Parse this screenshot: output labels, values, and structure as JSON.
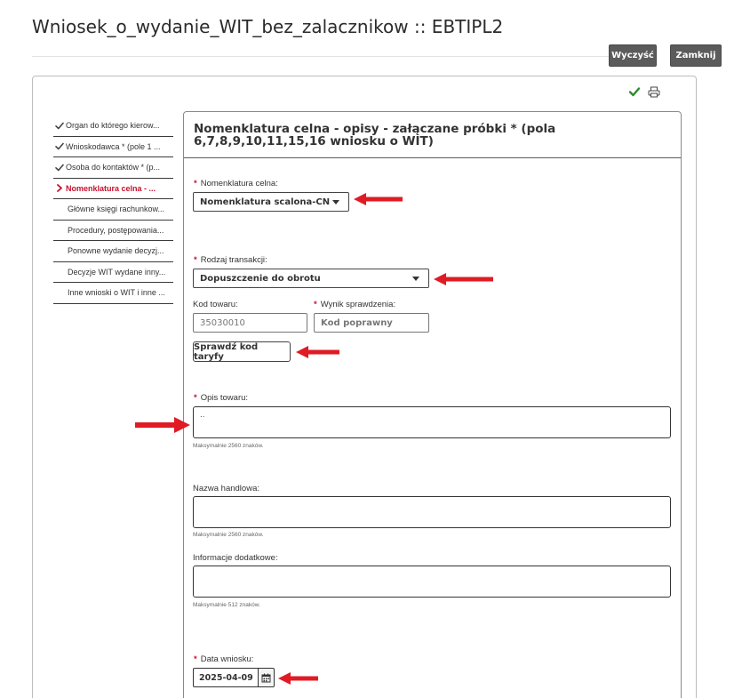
{
  "page": {
    "title": "Wniosek_o_wydanie_WIT_bez_zalacznikow :: EBTIPL2"
  },
  "toolbar": {
    "clear_label": "Wyczyść",
    "close_label": "Zamknij"
  },
  "icons": {
    "status": "check-icon",
    "print": "print-icon"
  },
  "colors": {
    "accent": "#c8102e",
    "check": "#2e8b2e",
    "button_dark": "#5b5b5b"
  },
  "sidebar": {
    "items": [
      {
        "label": "Organ do którego kierow...",
        "state": "done"
      },
      {
        "label": "Wnioskodawca * (pole 1 ...",
        "state": "done"
      },
      {
        "label": "Osoba do kontaktów * (p...",
        "state": "done"
      },
      {
        "label": "Nomenklatura celna - ...",
        "state": "active"
      },
      {
        "label": "Główne księgi rachunkow...",
        "state": "none"
      },
      {
        "label": "Procedury, postępowania...",
        "state": "none"
      },
      {
        "label": "Ponowne wydanie decyzj...",
        "state": "none"
      },
      {
        "label": "Decyzje WIT wydane inny...",
        "state": "none"
      },
      {
        "label": "Inne wnioski o WIT i inne ...",
        "state": "none"
      }
    ]
  },
  "section": {
    "title": "Nomenklatura celna - opisy - załączane próbki * (pola 6,7,8,9,10,11,15,16 wniosku o WIT)"
  },
  "form": {
    "required_mark": "*",
    "nomenclature": {
      "label": "Nomenklatura celna:",
      "value": "Nomenklatura scalona-CN"
    },
    "transaction": {
      "label": "Rodzaj transakcji:",
      "value": "Dopuszczenie do obrotu"
    },
    "goods_code": {
      "label": "Kod towaru:",
      "value": "35030010"
    },
    "check_result": {
      "label": "Wynik sprawdzenia:",
      "value": "Kod poprawny"
    },
    "check_button": "Sprawdź kod taryfy",
    "description": {
      "label": "Opis towaru:",
      "value": "..",
      "hint": "Maksymalnie 2560 znaków."
    },
    "trade_name": {
      "label": "Nazwa handlowa:",
      "value": "",
      "hint": "Maksymalnie 2560 znaków."
    },
    "additional_info": {
      "label": "Informacje dodatkowe:",
      "value": "",
      "hint": "Maksymalnie 512 znaków."
    },
    "request_date": {
      "label": "Data wniosku:",
      "value": "2025-04-09"
    }
  }
}
